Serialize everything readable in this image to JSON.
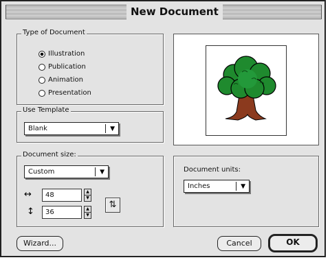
{
  "window": {
    "title": "New Document"
  },
  "type_of_document": {
    "label": "Type of Document",
    "options": [
      {
        "label": "Illustration",
        "selected": true
      },
      {
        "label": "Publication",
        "selected": false
      },
      {
        "label": "Animation",
        "selected": false
      },
      {
        "label": "Presentation",
        "selected": false
      }
    ]
  },
  "use_template": {
    "label": "Use Template",
    "value": "Blank"
  },
  "document_size": {
    "label": "Document size:",
    "preset": "Custom",
    "width": "48",
    "height": "36",
    "width_icon": "horizontal-arrow-icon",
    "height_icon": "vertical-arrow-icon",
    "swap_icon": "swap-orientation-icon"
  },
  "document_units": {
    "label": "Document units:",
    "value": "Inches"
  },
  "preview": {
    "image": "tree-illustration-icon",
    "colors": {
      "foliage": "#1f8a2e",
      "trunk": "#8b3a1e"
    }
  },
  "buttons": {
    "wizard": "Wizard...",
    "cancel": "Cancel",
    "ok": "OK"
  }
}
